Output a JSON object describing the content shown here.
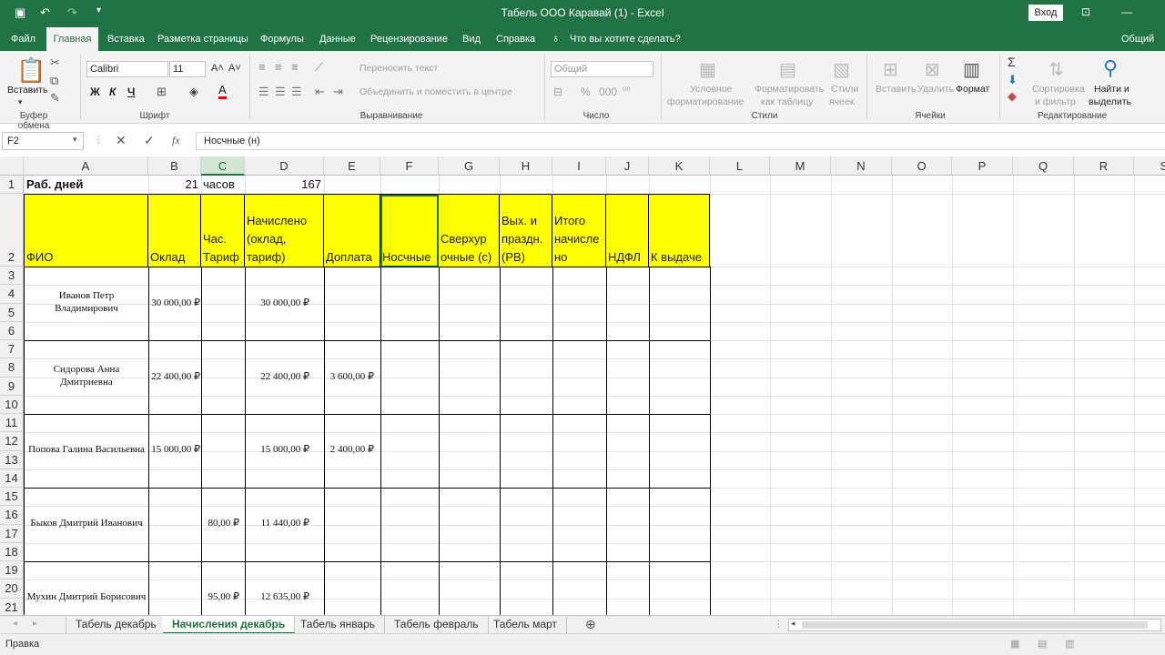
{
  "window": {
    "title": "Табель ООО Каравай (1)  -  Excel",
    "signin": "Вход",
    "share": "Общий"
  },
  "menu": {
    "tabs": [
      "Файл",
      "Главная",
      "Вставка",
      "Разметка страницы",
      "Формулы",
      "Данные",
      "Рецензирование",
      "Вид",
      "Справка"
    ],
    "tell_me": "Что вы хотите сделать?"
  },
  "ribbon": {
    "clipboard": {
      "paste": "Вставить",
      "label": "Буфер обмена"
    },
    "font": {
      "name": "Calibri",
      "size": "11",
      "bold": "Ж",
      "italic": "К",
      "underline": "Ч",
      "label": "Шрифт"
    },
    "alignment": {
      "wrap": "Переносить текст",
      "merge": "Объединить и поместить в центре",
      "label": "Выравнивание"
    },
    "number": {
      "format": "Общий",
      "label": "Число"
    },
    "styles": {
      "cond1": "Условное",
      "cond2": "форматирование",
      "table1": "Форматировать",
      "table2": "как таблицу",
      "cell1": "Стили",
      "cell2": "ячеек",
      "label": "Стили"
    },
    "cells": {
      "insert": "Вставить",
      "delete": "Удалить",
      "format": "Формат",
      "label": "Ячейки"
    },
    "editing": {
      "sort1": "Сортировка",
      "sort2": "и фильтр",
      "find1": "Найти и",
      "find2": "выделить",
      "label": "Редактирование"
    }
  },
  "formula_bar": {
    "name_box": "F2",
    "fx": "fx",
    "content": "Носчные (н)"
  },
  "columns": [
    "A",
    "B",
    "C",
    "D",
    "E",
    "F",
    "G",
    "H",
    "I",
    "J",
    "K",
    "L",
    "M",
    "N",
    "O",
    "P",
    "Q",
    "R",
    "S"
  ],
  "rows": [
    "1",
    "2",
    "3",
    "4",
    "5",
    "6",
    "7",
    "8",
    "9",
    "10",
    "11",
    "12",
    "13",
    "14",
    "15",
    "16",
    "17",
    "18",
    "19",
    "20",
    "21"
  ],
  "sheet": {
    "row1": {
      "a": "Раб. дней",
      "b": "21",
      "c": "часов",
      "d": "167"
    },
    "headers": [
      "ФИО",
      "Оклад",
      "Час.\nТариф",
      "Начислено\n(оклад,\nтариф)",
      "Доплата",
      "Носчные",
      "Сверхур\nочные (с)",
      "Вых. и\nпраздн.\n(РВ)",
      "Итого\nначисле\nно",
      "НДФЛ",
      "К выдаче"
    ],
    "employees": [
      {
        "name": "Иванов Петр\nВладимирович",
        "oklad": "30 000,00 ₽",
        "tarif": "",
        "nachisleno": "30 000,00 ₽",
        "doplata": ""
      },
      {
        "name": "Сидорова Анна\nДмитриевна",
        "oklad": "22 400,00 ₽",
        "tarif": "",
        "nachisleno": "22 400,00 ₽",
        "doplata": "3 600,00 ₽"
      },
      {
        "name": "Попова Галина Васильевна",
        "oklad": "15 000,00 ₽",
        "tarif": "",
        "nachisleno": "15 000,00 ₽",
        "doplata": "2 400,00 ₽"
      },
      {
        "name": "Быков Дмитрий Иванович",
        "oklad": "",
        "tarif": "80,00 ₽",
        "nachisleno": "11 440,00 ₽",
        "doplata": ""
      },
      {
        "name": "Мухин Дмитрий Борисович",
        "oklad": "",
        "tarif": "95,00 ₽",
        "nachisleno": "12 635,00 ₽",
        "doplata": ""
      }
    ]
  },
  "sheet_tabs": [
    "Табель декабрь",
    "Начисления декабрь",
    "Табель январь",
    "Табель февраль",
    "Табель март"
  ],
  "active_sheet": "Начисления декабрь",
  "status": "Правка",
  "colors": {
    "excel_green": "#217346",
    "header_fill": "#ffff00"
  }
}
